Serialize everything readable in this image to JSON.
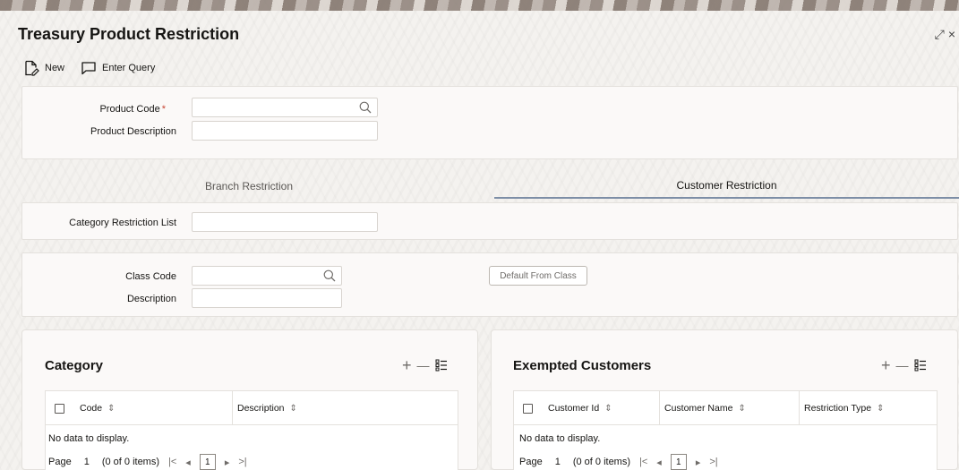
{
  "window": {
    "title": "Treasury Product Restriction",
    "controls": [
      "⤢",
      "×"
    ]
  },
  "toolbar": {
    "new_label": "New",
    "enter_query_label": "Enter Query"
  },
  "header_form": {
    "product_code_label": "Product Code",
    "product_code_required": "*",
    "product_code_value": "",
    "product_description_label": "Product Description",
    "product_description_value": ""
  },
  "tabs": [
    {
      "label": "Branch Restriction",
      "active": false
    },
    {
      "label": "Customer Restriction",
      "active": true
    }
  ],
  "category_restriction": {
    "label": "Category Restriction List",
    "value": ""
  },
  "class_section": {
    "class_code_label": "Class Code",
    "class_code_value": "",
    "description_label": "Description",
    "description_value": "",
    "default_button_label": "Default From Class"
  },
  "category_card": {
    "title": "Category",
    "columns": [
      "Code",
      "Description"
    ],
    "empty_text": "No data to display.",
    "pager": {
      "page_label": "Page",
      "page_value": "1",
      "items_text": "(0 of 0 items)",
      "current": "1"
    }
  },
  "exempted_card": {
    "title": "Exempted Customers",
    "columns": [
      "Customer Id",
      "Customer Name",
      "Restriction Type"
    ],
    "empty_text": "No data to display.",
    "pager": {
      "page_label": "Page",
      "page_value": "1",
      "items_text": "(0 of 0 items)",
      "current": "1"
    }
  },
  "icons": {
    "add": "+",
    "remove": "—",
    "sort": "⇕",
    "first": "|<",
    "prev": "◂",
    "next": "▸",
    "last": ">|"
  },
  "colors": {
    "active_tab_underline": "#7d8ea6",
    "required": "#c74634"
  }
}
